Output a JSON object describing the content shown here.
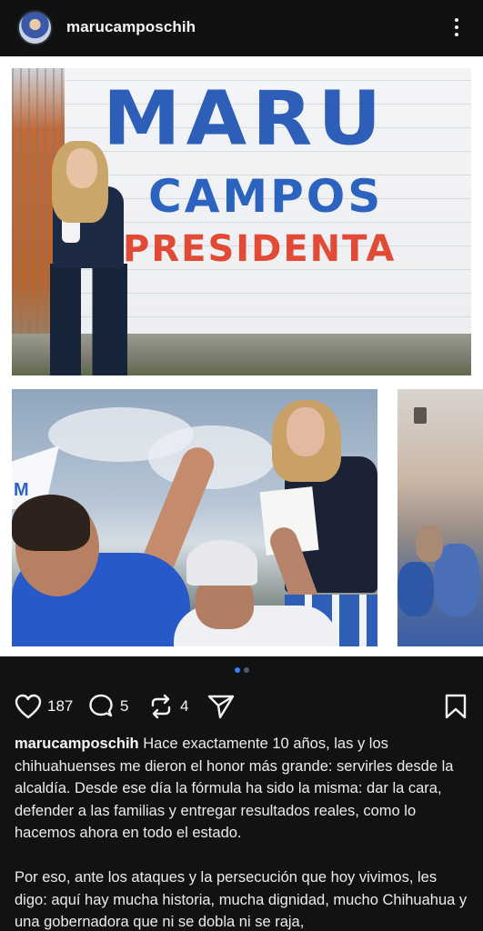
{
  "header": {
    "username": "marucamposchih",
    "avatar_icon": "profile-avatar",
    "menu_icon": "more-vertical-icon"
  },
  "carousel": {
    "mural_text": {
      "line1": "MARU",
      "line2": "CAMPOS",
      "line3": "PRESIDENTA"
    },
    "rally_flag_text": "M",
    "total_slides": 2,
    "active_slide": 1
  },
  "actions": {
    "likes": "187",
    "comments": "5",
    "reposts": "4",
    "like_icon": "heart-icon",
    "comment_icon": "comment-icon",
    "repost_icon": "repost-icon",
    "share_icon": "send-icon",
    "save_icon": "bookmark-icon"
  },
  "caption": {
    "username": "marucamposchih",
    "paragraph1": "Hace exactamente 10 años, las y los chihuahuenses me dieron el honor más grande: servirles desde la alcaldía. Desde ese día la fórmula ha sido la misma: dar la cara, defender a las familias y entregar resultados reales, como lo hacemos ahora en todo el estado.",
    "paragraph2": "Por eso, ante los ataques y la persecución que hoy vivimos, les digo: aquí hay mucha historia, mucha dignidad, mucho Chihuahua y una gobernadora que ni se dobla ni se raja,"
  },
  "colors": {
    "background": "#101214",
    "accent_blue": "#3b7ff2",
    "mural_blue": "#2e5fb8",
    "mural_red": "#e14a34"
  }
}
